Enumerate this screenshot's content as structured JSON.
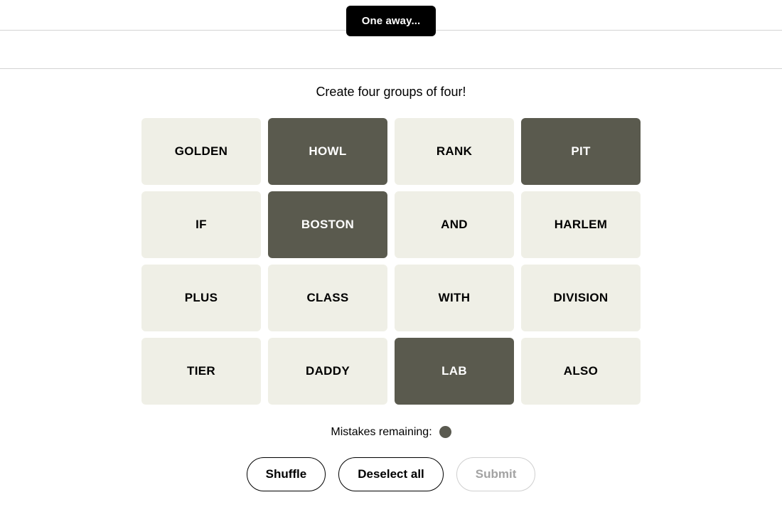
{
  "toast": {
    "message": "One away..."
  },
  "header": {
    "content": ""
  },
  "game": {
    "instruction": "Create four groups of four!",
    "tiles": [
      {
        "label": "GOLDEN",
        "state": "unselected"
      },
      {
        "label": "HOWL",
        "state": "selected"
      },
      {
        "label": "RANK",
        "state": "unselected"
      },
      {
        "label": "PIT",
        "state": "selected"
      },
      {
        "label": "IF",
        "state": "unselected"
      },
      {
        "label": "BOSTON",
        "state": "selected"
      },
      {
        "label": "AND",
        "state": "unselected"
      },
      {
        "label": "HARLEM",
        "state": "unselected"
      },
      {
        "label": "PLUS",
        "state": "unselected"
      },
      {
        "label": "CLASS",
        "state": "unselected"
      },
      {
        "label": "WITH",
        "state": "unselected"
      },
      {
        "label": "DIVISION",
        "state": "unselected"
      },
      {
        "label": "TIER",
        "state": "unselected"
      },
      {
        "label": "DADDY",
        "state": "unselected"
      },
      {
        "label": "LAB",
        "state": "selected"
      },
      {
        "label": "ALSO",
        "state": "unselected"
      }
    ],
    "mistakes": {
      "label": "Mistakes remaining:",
      "remaining": 1
    },
    "controls": {
      "shuffle": "Shuffle",
      "deselect": "Deselect all",
      "submit": "Submit",
      "submit_enabled": false
    }
  },
  "colors": {
    "tile_unselected_bg": "#efefe6",
    "tile_selected_bg": "#5a5a4e",
    "tile_unselected_text": "#000000",
    "tile_selected_text": "#ffffff",
    "toast_bg": "#000000",
    "toast_text": "#ffffff",
    "mistake_dot": "#5a5a50",
    "divider": "#d3d3d3",
    "disabled_text": "#a3a3a3",
    "disabled_border": "#cfcfcf",
    "page_bg": "#ffffff"
  }
}
